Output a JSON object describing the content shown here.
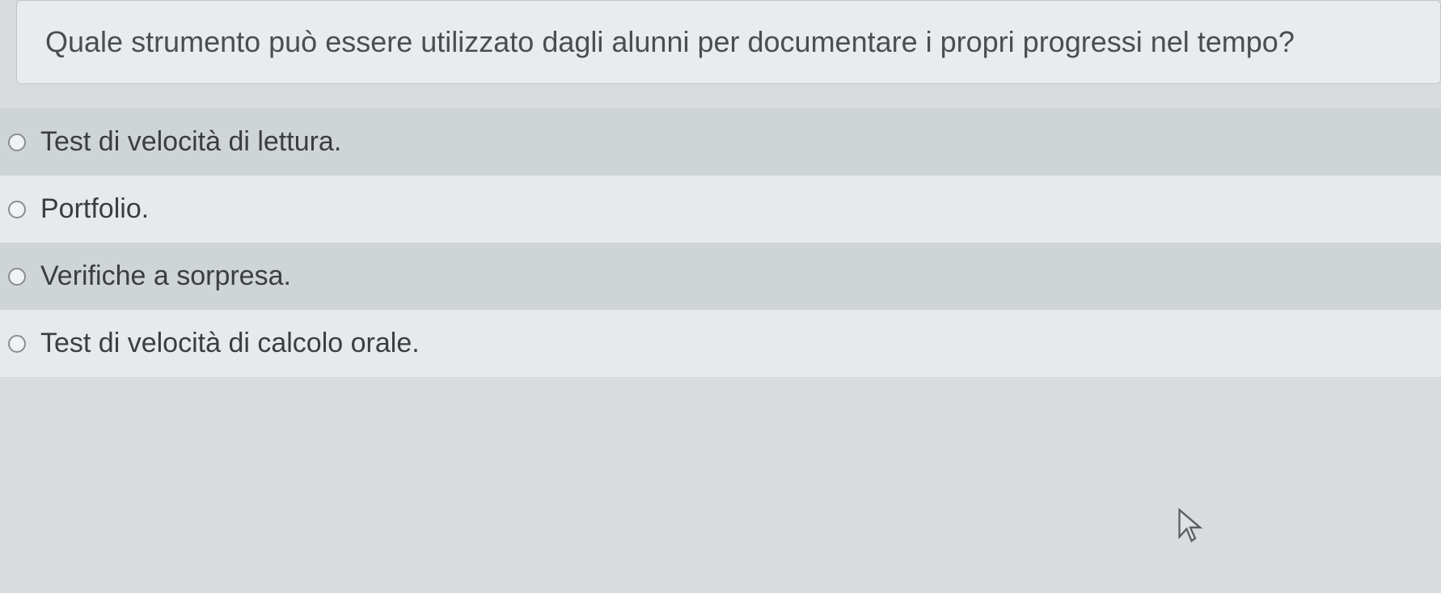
{
  "question": {
    "text": "Quale strumento può essere utilizzato dagli alunni per documentare i propri progressi nel tempo?"
  },
  "options": [
    {
      "label": "Test di velocità di lettura."
    },
    {
      "label": "Portfolio."
    },
    {
      "label": "Verifiche a sorpresa."
    },
    {
      "label": "Test di velocità di calcolo orale."
    }
  ]
}
